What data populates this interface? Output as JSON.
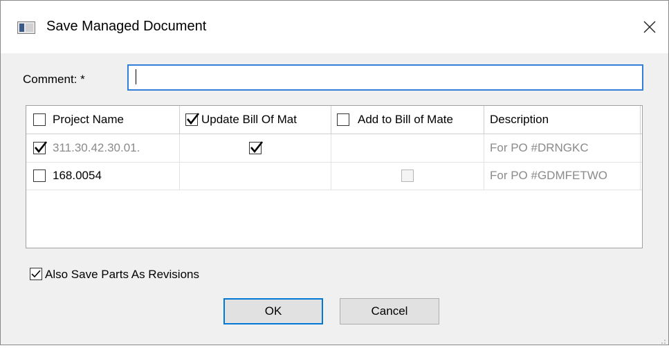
{
  "window": {
    "title": "Save Managed Document",
    "close_icon": "close-icon",
    "app_icon": "window-icon"
  },
  "comment": {
    "label": "Comment:  *",
    "value": ""
  },
  "grid": {
    "columns": [
      {
        "label": "Project Name",
        "checked": false
      },
      {
        "label": "Update Bill Of Mat",
        "checked": true
      },
      {
        "label": "Add to Bill of Mate",
        "checked": false
      },
      {
        "label": "Description"
      }
    ],
    "rows": [
      {
        "select_checked": true,
        "project_name": "311.30.42.30.01.",
        "update_bom_checked": true,
        "add_bom": null,
        "description": "For PO #DRNGKC"
      },
      {
        "select_checked": false,
        "project_name": "168.0054",
        "update_bom_checked": null,
        "add_bom": "disabled-unchecked",
        "description": "For PO #GDMFETWO"
      }
    ]
  },
  "options": {
    "also_save_parts_label": "Also Save Parts As Revisions",
    "also_save_parts_checked": true
  },
  "buttons": {
    "ok_label": "OK",
    "cancel_label": "Cancel"
  }
}
